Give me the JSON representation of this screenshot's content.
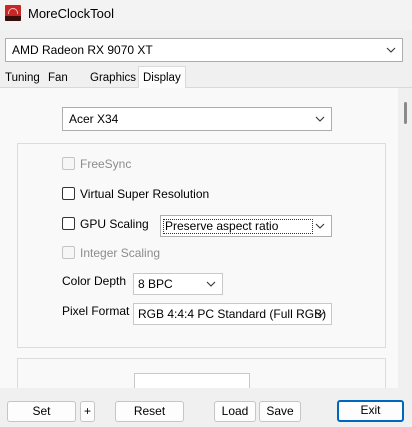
{
  "window": {
    "title": "MoreClockTool"
  },
  "gpu_select": {
    "value": "AMD Radeon RX 9070 XT"
  },
  "tabs": [
    {
      "label": "Tuning",
      "active": false
    },
    {
      "label": "Fan",
      "active": false
    },
    {
      "label": "Graphics",
      "active": false
    },
    {
      "label": "Display",
      "active": true
    }
  ],
  "display": {
    "monitor_select": {
      "value": "Acer X34"
    },
    "freesync": {
      "label": "FreeSync",
      "checked": false,
      "enabled": false
    },
    "vsr": {
      "label": "Virtual Super Resolution",
      "checked": false,
      "enabled": true
    },
    "gpu_scaling": {
      "label": "GPU Scaling",
      "checked": false,
      "enabled": true,
      "mode_value": "Preserve aspect ratio"
    },
    "integer_scaling": {
      "label": "Integer Scaling",
      "checked": false,
      "enabled": false
    },
    "color_depth": {
      "label": "Color Depth",
      "value": "8 BPC"
    },
    "pixel_format": {
      "label": "Pixel Format",
      "value": "RGB 4:4:4 PC Standard (Full RGB)"
    }
  },
  "buttons": {
    "set": "Set",
    "plus": "+",
    "reset": "Reset",
    "load": "Load",
    "save": "Save",
    "exit": "Exit"
  },
  "colors": {
    "accent": "#0067c0",
    "app_icon": "#c62828"
  }
}
